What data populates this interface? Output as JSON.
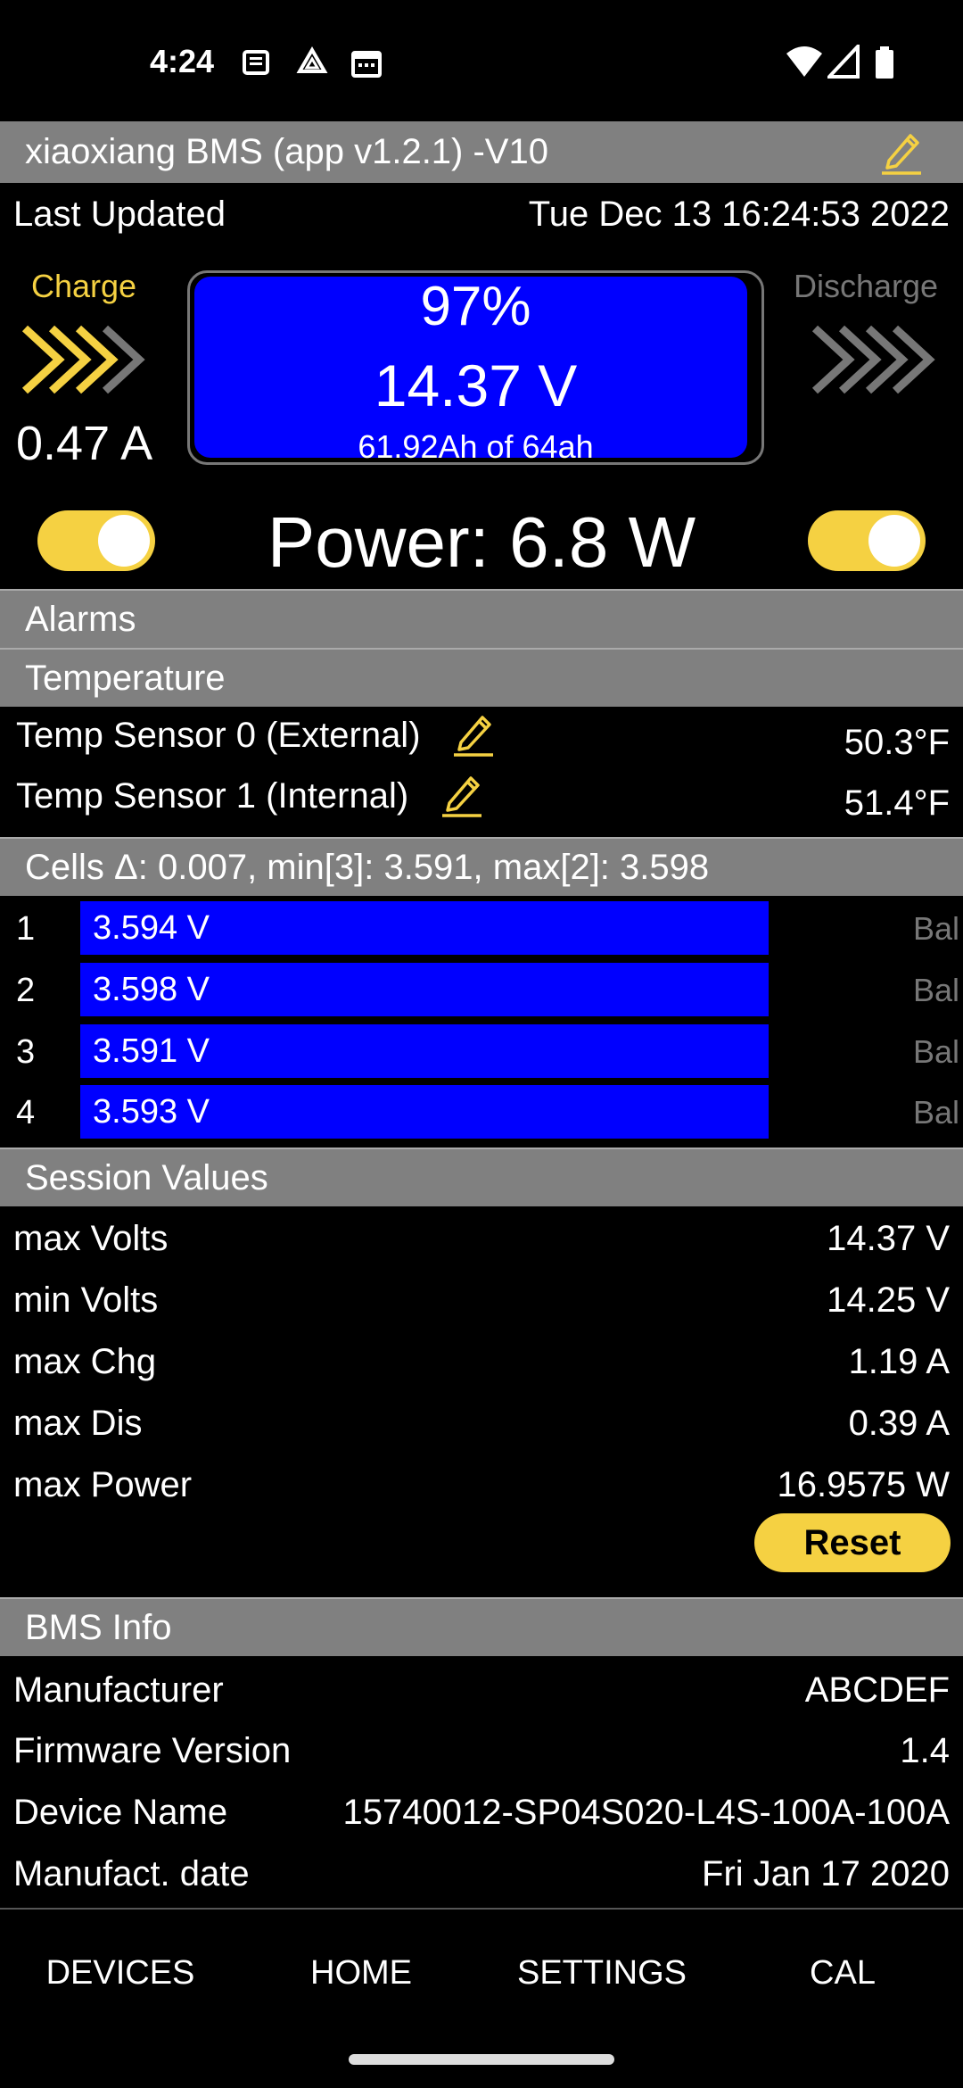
{
  "status": {
    "time": "4:24"
  },
  "header": {
    "title": "xiaoxiang BMS (app v1.2.1) -V10"
  },
  "last_updated": {
    "label": "Last Updated",
    "value": "Tue Dec 13 16:24:53 2022"
  },
  "charge": {
    "label": "Charge",
    "current": "0.47 A",
    "enabled": true
  },
  "discharge": {
    "label": "Discharge",
    "enabled": true
  },
  "battery": {
    "percent": "97%",
    "voltage": "14.37 V",
    "capacity": "61.92Ah of 64ah",
    "fill_fraction": 0.97
  },
  "power": "Power: 6.8 W",
  "sections": {
    "alarms": "Alarms",
    "temperature": "Temperature",
    "cells": "Cells Δ: 0.007, min[3]: 3.591, max[2]: 3.598",
    "session": "Session Values",
    "bms_info": "BMS Info"
  },
  "temps": [
    {
      "label": "Temp Sensor 0 (External)",
      "value": "50.3°F"
    },
    {
      "label": "Temp Sensor 1 (Internal)",
      "value": "51.4°F"
    }
  ],
  "cells": [
    {
      "num": "1",
      "voltage": "3.594 V",
      "bal": "Bal"
    },
    {
      "num": "2",
      "voltage": "3.598 V",
      "bal": "Bal"
    },
    {
      "num": "3",
      "voltage": "3.591 V",
      "bal": "Bal"
    },
    {
      "num": "4",
      "voltage": "3.593 V",
      "bal": "Bal"
    }
  ],
  "session": [
    {
      "label": "max Volts",
      "value": "14.37 V"
    },
    {
      "label": "min Volts",
      "value": "14.25 V"
    },
    {
      "label": "max Chg",
      "value": "1.19 A"
    },
    {
      "label": "max Dis",
      "value": "0.39 A"
    },
    {
      "label": "max Power",
      "value": "16.9575 W"
    }
  ],
  "reset_label": "Reset",
  "bms_info": [
    {
      "label": "Manufacturer",
      "value": "ABCDEF"
    },
    {
      "label": "Firmware Version",
      "value": "1.4"
    },
    {
      "label": "Device Name",
      "value": "15740012-SP04S020-L4S-100A-100A"
    },
    {
      "label": "Manufact. date",
      "value": "Fri Jan 17 2020"
    }
  ],
  "nav": [
    "DEVICES",
    "HOME",
    "SETTINGS",
    "CAL"
  ],
  "colors": {
    "accent": "#f5d142",
    "header_bg": "#808080",
    "cell_bar": "#0000ff"
  },
  "icons": [
    "news-icon",
    "drive-icon",
    "calendar-icon",
    "wifi-icon",
    "signal-icon",
    "battery-icon",
    "pencil-icon",
    "chevrons-icon"
  ]
}
